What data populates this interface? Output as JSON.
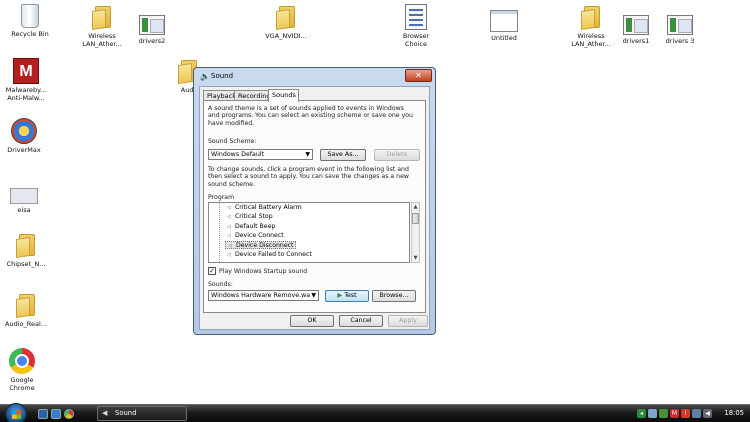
{
  "desktop": {
    "icons": [
      {
        "label_lines": [
          "Recycle Bin"
        ],
        "kind": "recycle"
      },
      {
        "label_lines": [
          "Wireless",
          "LAN_Ather..."
        ],
        "kind": "folder"
      },
      {
        "label_lines": [
          "drivers2"
        ],
        "kind": "thumb"
      },
      {
        "label_lines": [
          "VGA_NVIDI..."
        ],
        "kind": "folder"
      },
      {
        "label_lines": [
          "Browser",
          "Choice"
        ],
        "kind": "browser-choice"
      },
      {
        "label_lines": [
          "Untitled"
        ],
        "kind": "untitled"
      },
      {
        "label_lines": [
          "Wireless",
          "LAN_Ather..."
        ],
        "kind": "folder"
      },
      {
        "label_lines": [
          "drivers1"
        ],
        "kind": "thumb"
      },
      {
        "label_lines": [
          "drivers 3"
        ],
        "kind": "thumb"
      },
      {
        "label_lines": [
          "Malwareby...",
          "Anti-Malw..."
        ],
        "kind": "malwarebytes"
      },
      {
        "label_lines": [
          "DriverMax"
        ],
        "kind": "drivermax"
      },
      {
        "label_lines": [
          "eisa"
        ],
        "kind": "eisa"
      },
      {
        "label_lines": [
          "Chipset_N..."
        ],
        "kind": "folder"
      },
      {
        "label_lines": [
          "Audio_Real..."
        ],
        "kind": "folder"
      },
      {
        "label_lines": [
          "Google",
          "Chrome"
        ],
        "kind": "chrome"
      },
      {
        "label_lines": [
          "Audi"
        ],
        "kind": "folder"
      }
    ]
  },
  "dialog": {
    "title": "Sound",
    "close_glyph": "✕",
    "tabs": [
      "Playback",
      "Recording",
      "Sounds"
    ],
    "active_tab": "Sounds",
    "intro_lines": [
      "A sound theme is a set of sounds applied to events in Windows",
      "and programs.  You can select an existing scheme or save one you",
      "have modified."
    ],
    "scheme_label": "Sound Scheme:",
    "scheme_value": "Windows Default",
    "save_as_label": "Save As...",
    "delete_label": "Delete",
    "change_lines": [
      "To change sounds, click a program event in the following list and",
      "then select a sound to apply.  You can save the changes as a new",
      "sound scheme."
    ],
    "program_label": "Program",
    "program_items": [
      "Critical Battery Alarm",
      "Critical Stop",
      "Default Beep",
      "Device Connect",
      "Device Disconnect",
      "Device Failed to Connect"
    ],
    "selected_item": "Device Disconnect",
    "startup_checkbox_checked": true,
    "startup_checkbox_label": "Play Windows Startup sound",
    "sounds_label": "Sounds:",
    "sound_value": "Windows Hardware Remove.wa",
    "test_label": "Test",
    "browse_label": "Browse...",
    "ok_label": "OK",
    "cancel_label": "Cancel",
    "apply_label": "Apply"
  },
  "taskbar": {
    "active_window": "Sound",
    "clock": "18:05"
  }
}
